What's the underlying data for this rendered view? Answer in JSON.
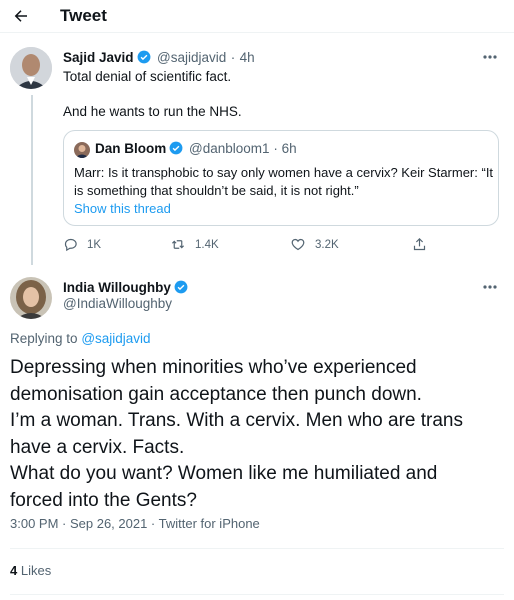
{
  "header": {
    "title": "Tweet"
  },
  "parent_tweet": {
    "author_name": "Sajid Javid",
    "author_handle": "@sajidjavid",
    "separator": "·",
    "time": "4h",
    "text_line1": "Total denial of scientific fact.",
    "text_line2": "And he wants to run the NHS.",
    "quote": {
      "author_name": "Dan Bloom",
      "author_handle": "@danbloom1",
      "separator": "·",
      "time": "6h",
      "text": "Marr: Is it transphobic to say only women have a cervix? Keir Starmer: “It is something that shouldn’t be said, it is not right.”",
      "link": "Show this thread"
    },
    "actions": {
      "replies": "1K",
      "retweets": "1.4K",
      "likes": "3.2K"
    }
  },
  "main_tweet": {
    "author_name": "India Willoughby",
    "author_handle": "@IndiaWilloughby",
    "replying_prefix": "Replying to",
    "replying_to": "@sajidjavid",
    "text_lines": [
      "Depressing when minorities who’ve experienced",
      "demonisation gain acceptance then punch down.",
      "I’m a woman. Trans. With a cervix. Men who are trans",
      "have a cervix. Facts.",
      "What do you want? Women like me humiliated and",
      "forced into the Gents?"
    ],
    "timestamp": "3:00 PM · Sep 26, 2021 · Twitter for iPhone",
    "likes_count": "4",
    "likes_label": "Likes"
  },
  "icons": {
    "back": "arrow-left-icon",
    "verified": "verified-badge-icon",
    "more": "more-dots-icon",
    "reply": "reply-icon",
    "retweet": "retweet-icon",
    "like": "heart-icon",
    "share": "share-icon"
  },
  "colors": {
    "accent": "#1d9bf0",
    "text": "#0f1419",
    "secondary": "#536471",
    "border": "#cfd9de"
  }
}
